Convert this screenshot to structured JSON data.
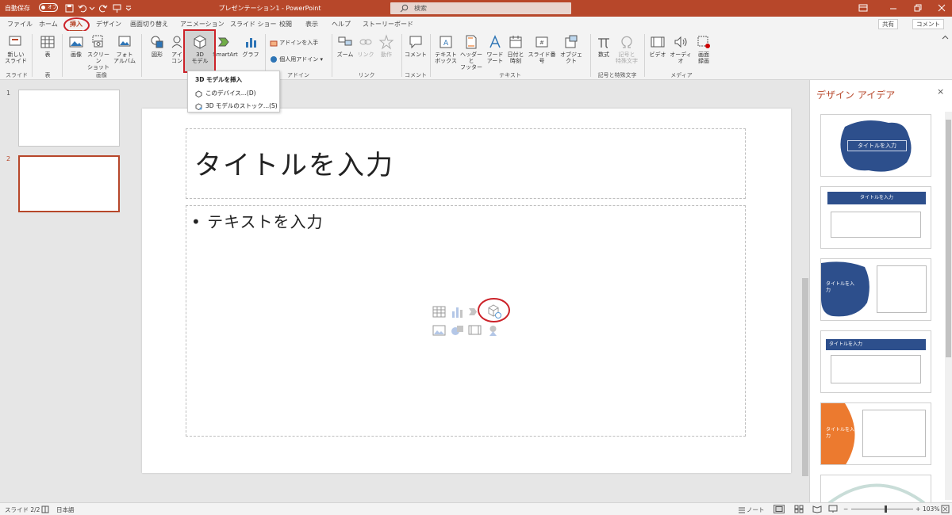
{
  "titlebar": {
    "autosave_label": "自動保存",
    "autosave_state": "オフ",
    "doc_title": "プレゼンテーション1  -  PowerPoint",
    "search_placeholder": "検索",
    "color": "#b7472a"
  },
  "tabs": [
    {
      "label": "ファイル"
    },
    {
      "label": "ホーム"
    },
    {
      "label": "挿入",
      "active": true
    },
    {
      "label": "デザイン"
    },
    {
      "label": "画面切り替え"
    },
    {
      "label": "アニメーション"
    },
    {
      "label": "スライド ショー"
    },
    {
      "label": "校閲"
    },
    {
      "label": "表示"
    },
    {
      "label": "ヘルプ"
    },
    {
      "label": "ストーリーボード"
    }
  ],
  "share_label": "共有",
  "comment_label": "コメント",
  "ribbon": {
    "new_slide": "新しい\nスライド",
    "table": "表",
    "image": "画像",
    "screenshot": "スクリーン\nショット",
    "photo_album": "フォト\nアルバム",
    "shapes": "図形",
    "icons": "アイ\nコン",
    "model3d": "3D\nモデル",
    "smartart": "SmartArt",
    "graph": "グラフ",
    "get_addins": "アドインを入手",
    "my_addins": "個人用アドイン",
    "zoom": "ズーム",
    "link": "リンク",
    "action": "動作",
    "comment": "コメント",
    "textbox": "テキスト\nボックス",
    "header_footer": "ヘッダーと\nフッター",
    "wordart": "ワード\nアート",
    "datetime": "日付と\n時刻",
    "slide_number": "スライド番号",
    "object": "オブジェクト",
    "equation": "数式",
    "symbol": "記号と\n特殊文字",
    "video": "ビデオ",
    "audio": "オーディオ",
    "screen_record": "画面\n録画",
    "groups": {
      "slides": "スライド",
      "tables": "表",
      "images": "画像",
      "addins": "アドイン",
      "links": "リンク",
      "comments": "コメント",
      "text": "テキスト",
      "symbols": "記号と特殊文字",
      "media": "メディア"
    }
  },
  "dropdown": {
    "header": "3D モデルを挿入",
    "item1": "このデバイス...(D)",
    "item2": "3D モデルのストック...(S)"
  },
  "thumbnails": [
    {
      "num": "1"
    },
    {
      "num": "2"
    }
  ],
  "slide": {
    "title_placeholder": "タイトルを入力",
    "body_placeholder": "• テキストを入力"
  },
  "design_pane": {
    "title": "デザイン アイデア",
    "close": "×",
    "ideas": [
      {
        "text": "タイトルを入力"
      },
      {
        "text": "タイトルを入力"
      },
      {
        "text": "タイトルを入力"
      },
      {
        "text": "タイトルを入力"
      },
      {
        "text": "タイトルを入力"
      }
    ]
  },
  "status": {
    "slide_info": "スライド 2/2",
    "language": "日本語",
    "notes": "ノート",
    "zoom": "103%",
    "zoom_fraction": 0.55
  }
}
